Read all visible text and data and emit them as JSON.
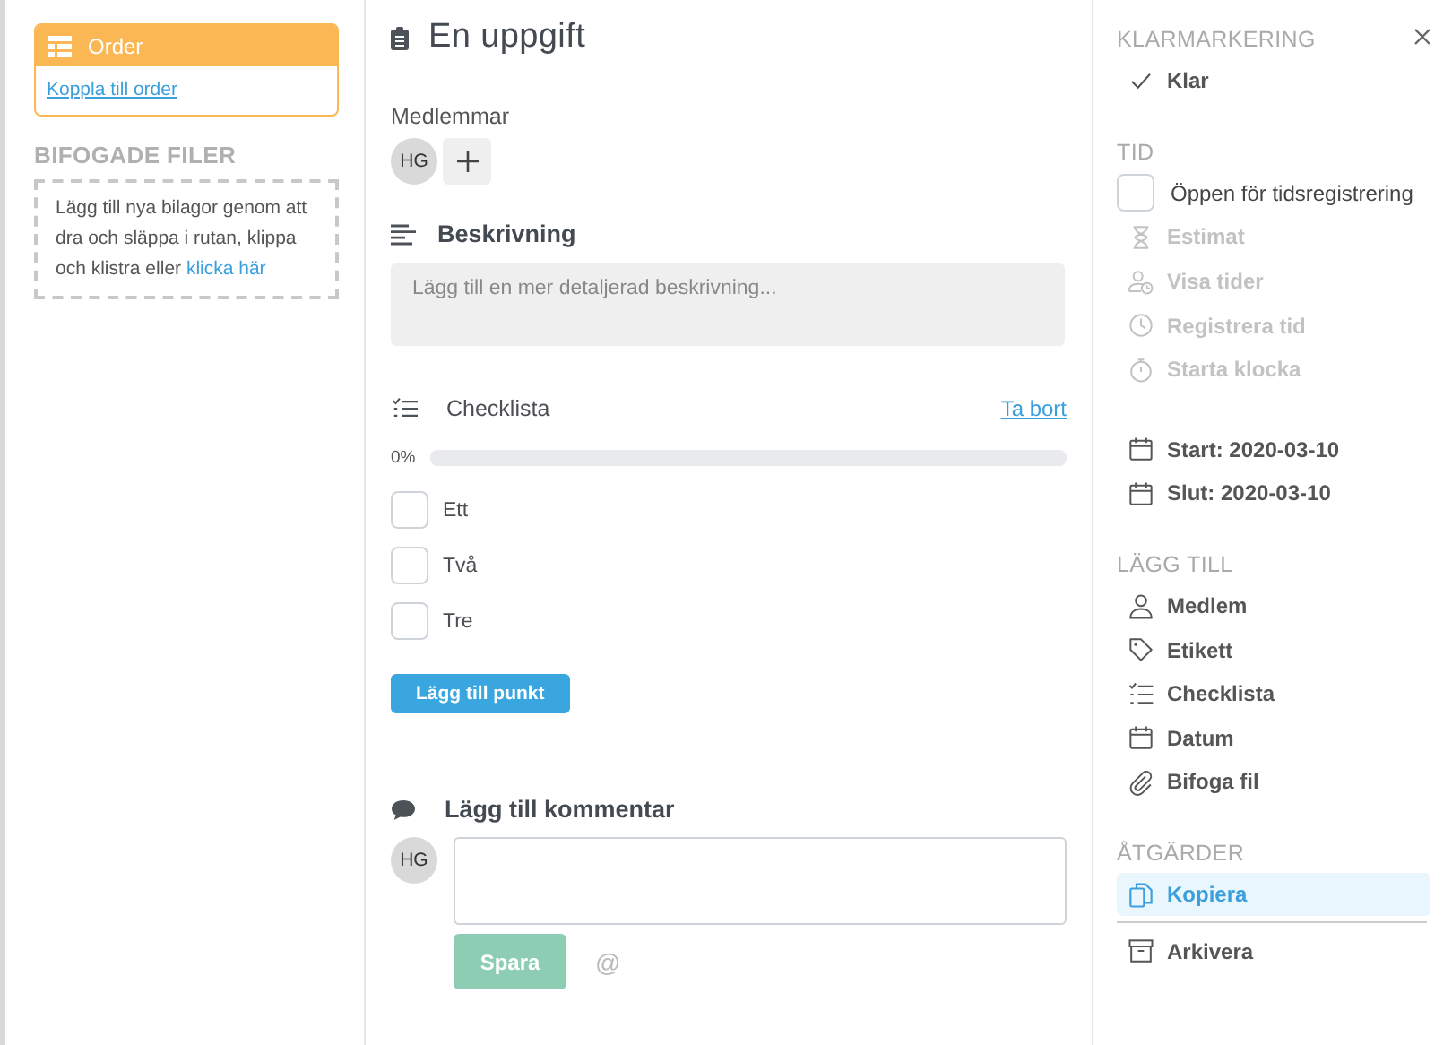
{
  "order_card": {
    "title": "Order",
    "link": "Koppla till order"
  },
  "attachments": {
    "heading": "BIFOGADE FILER",
    "text": "Lägg till nya bilagor genom att dra och släppa i rutan, klippa och klistra eller ",
    "link": "klicka här"
  },
  "task": {
    "title": "En uppgift",
    "members_label": "Medlemmar",
    "members": [
      {
        "initials": "HG"
      }
    ],
    "description": {
      "heading": "Beskrivning",
      "placeholder": "Lägg till en mer detaljerad beskrivning..."
    },
    "checklist": {
      "heading": "Checklista",
      "remove": "Ta bort",
      "percent": "0%",
      "level": 0,
      "items": [
        {
          "label": "Ett",
          "checked": false
        },
        {
          "label": "Två",
          "checked": false
        },
        {
          "label": "Tre",
          "checked": false
        }
      ],
      "add_button": "Lägg till punkt"
    },
    "comment": {
      "heading": "Lägg till kommentar",
      "avatar": "HG",
      "save": "Spara",
      "save_disabled": true,
      "mention": "@"
    }
  },
  "sidebar": {
    "sections": [
      {
        "heading": "KLARMARKERING",
        "items": [
          {
            "kind": "check",
            "label": "Klar",
            "disabled": false
          }
        ]
      },
      {
        "heading": "TID",
        "items": [
          {
            "kind": "checkbox",
            "label": "Öppen för tidsregistrering",
            "checked": false,
            "disabled": false
          },
          {
            "kind": "hourglass",
            "label": "Estimat",
            "disabled": true
          },
          {
            "kind": "personclock",
            "label": "Visa tider",
            "disabled": true
          },
          {
            "kind": "clock",
            "label": "Registrera tid",
            "disabled": true
          },
          {
            "kind": "stopwatch",
            "label": "Starta klocka",
            "disabled": true
          }
        ],
        "dates": [
          {
            "kind": "calendar",
            "label": "Start: 2020-03-10",
            "disabled": false
          },
          {
            "kind": "calendar",
            "label": "Slut: 2020-03-10",
            "disabled": false
          }
        ]
      },
      {
        "heading": "LÄGG TILL",
        "items": [
          {
            "kind": "person",
            "label": "Medlem",
            "disabled": false
          },
          {
            "kind": "tag",
            "label": "Etikett",
            "disabled": false
          },
          {
            "kind": "checklist",
            "label": "Checklista",
            "disabled": false
          },
          {
            "kind": "calendar",
            "label": "Datum",
            "disabled": false
          },
          {
            "kind": "paperclip",
            "label": "Bifoga fil",
            "disabled": false
          }
        ]
      },
      {
        "heading": "ÅTGÄRDER",
        "items": [
          {
            "kind": "copy",
            "label": "Kopiera",
            "selected": true,
            "disabled": false
          },
          {
            "kind": "archive",
            "label": "Arkivera",
            "selected": false,
            "disabled": false
          }
        ]
      }
    ]
  }
}
